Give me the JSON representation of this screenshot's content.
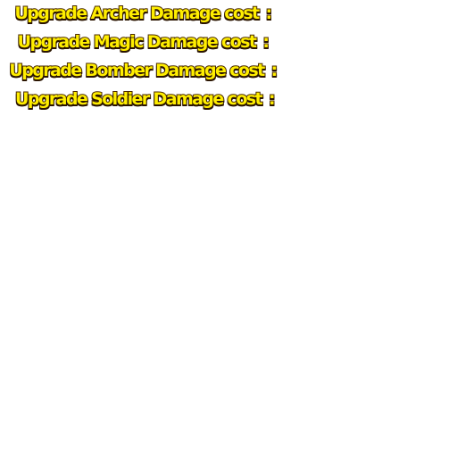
{
  "labels": {
    "archer": {
      "text": "Upgrade Archer Damage cost",
      "colon": ":"
    },
    "magic": {
      "text": "Upgrade Magic Damage cost",
      "colon": ":"
    },
    "bomber": {
      "text": "Upgrade Bomber Damage cost",
      "colon": ":"
    },
    "soldier": {
      "text": "Upgrade Soldier Damage cost",
      "colon": ":"
    }
  },
  "colors": {
    "text_fill": "#ffee00",
    "text_outline": "#4a2a00",
    "background": "#ffffff"
  }
}
